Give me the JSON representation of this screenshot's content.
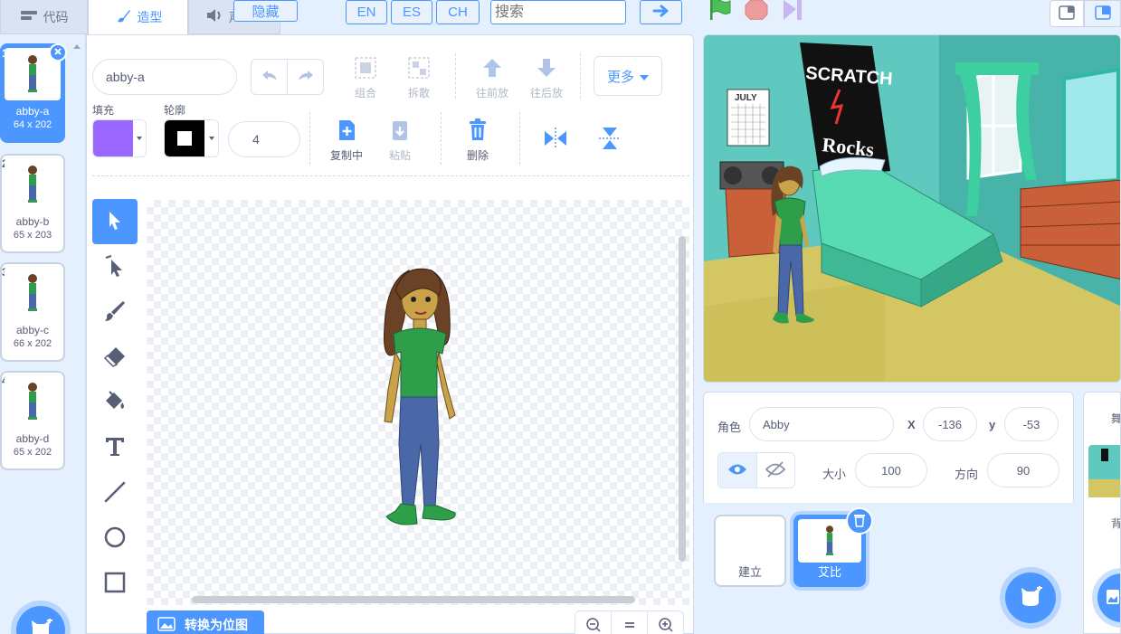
{
  "tabs": {
    "code": "代码",
    "costumes": "造型",
    "sounds": "声"
  },
  "top": {
    "hide": "隐藏",
    "lang_en": "EN",
    "lang_es": "ES",
    "lang_ch": "CH",
    "search_placeholder": "搜索"
  },
  "costumes": [
    {
      "num": "1",
      "name": "abby-a",
      "size": "64 x 202"
    },
    {
      "num": "2",
      "name": "abby-b",
      "size": "65 x 203"
    },
    {
      "num": "3",
      "name": "abby-c",
      "size": "66 x 202"
    },
    {
      "num": "4",
      "name": "abby-d",
      "size": "65 x 202"
    }
  ],
  "editor": {
    "costume_name": "abby-a",
    "group": "组合",
    "ungroup": "拆散",
    "forward": "往前放",
    "backward": "往后放",
    "more": "更多",
    "fill_label": "填充",
    "outline_label": "轮廓",
    "outline_width": "4",
    "copy": "复制中",
    "paste": "粘贴",
    "delete": "删除",
    "convert": "转换为位图",
    "fill_color": "#9966ff",
    "outline_color": "#000000"
  },
  "stage": {
    "poster_text_1": "SCRATCH",
    "poster_text_2": "Rocks",
    "calendar_text": "JULY"
  },
  "sprite": {
    "label_sprite": "角色",
    "name": "Abby",
    "label_x": "X",
    "x": "-136",
    "label_y": "y",
    "y": "-53",
    "label_size": "大小",
    "size": "100",
    "label_direction": "方向",
    "direction": "90"
  },
  "sprites": [
    {
      "name": "建立"
    },
    {
      "name": "艾比"
    }
  ],
  "backdrop_panel": {
    "title": "舞",
    "label": "背"
  }
}
